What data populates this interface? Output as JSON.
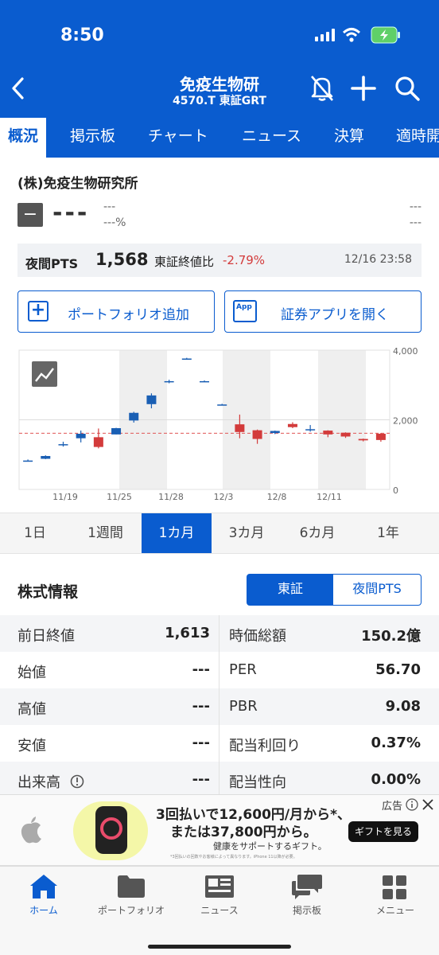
{
  "status_bar": {
    "time": "8:50"
  },
  "header": {
    "title": "免疫生物研",
    "subtitle": "4570.T 東証GRT"
  },
  "tabs": [
    "概況",
    "掲示板",
    "チャート",
    "ニュース",
    "決算",
    "適時開"
  ],
  "company": {
    "name": "(株)免疫生物研究所",
    "price": "---",
    "change": "---",
    "change_pct": "---%",
    "right_top": "---",
    "right_bottom": "---"
  },
  "pts": {
    "label": "夜間PTS",
    "value": "1,568",
    "compare_label": "東証終値比",
    "compare_value": "-2.79%",
    "timestamp": "12/16 23:58"
  },
  "buttons": {
    "portfolio": "ポートフォリオ追加",
    "open_app": "証券アプリを開く",
    "app_icon_text": "App"
  },
  "chart_data": {
    "type": "candlestick",
    "title": "",
    "xlabel": "",
    "ylabel": "",
    "ylim": [
      0,
      4000
    ],
    "y_ticks": [
      "4,000",
      "2,000",
      "0"
    ],
    "x_tick_labels": [
      "11/19",
      "11/25",
      "11/28",
      "12/3",
      "12/8",
      "12/11"
    ],
    "reference_line": 1613,
    "candles": [
      {
        "o": 830,
        "h": 860,
        "l": 800,
        "c": 830
      },
      {
        "o": 880,
        "h": 980,
        "l": 870,
        "c": 960
      },
      {
        "o": 1270,
        "h": 1370,
        "l": 1230,
        "c": 1300
      },
      {
        "o": 1470,
        "h": 1690,
        "l": 1350,
        "c": 1600
      },
      {
        "o": 1500,
        "h": 1750,
        "l": 1180,
        "c": 1220
      },
      {
        "o": 1580,
        "h": 1770,
        "l": 1580,
        "c": 1760
      },
      {
        "o": 1980,
        "h": 2230,
        "l": 1920,
        "c": 2200
      },
      {
        "o": 2450,
        "h": 2760,
        "l": 2330,
        "c": 2700
      },
      {
        "o": 3100,
        "h": 3150,
        "l": 3050,
        "c": 3110
      },
      {
        "o": 3760,
        "h": 3780,
        "l": 3730,
        "c": 3760
      },
      {
        "o": 3110,
        "h": 3130,
        "l": 3090,
        "c": 3110
      },
      {
        "o": 2440,
        "h": 2460,
        "l": 2420,
        "c": 2440
      },
      {
        "o": 1870,
        "h": 2150,
        "l": 1470,
        "c": 1650
      },
      {
        "o": 1700,
        "h": 1720,
        "l": 1310,
        "c": 1450
      },
      {
        "o": 1620,
        "h": 1690,
        "l": 1590,
        "c": 1680
      },
      {
        "o": 1880,
        "h": 1930,
        "l": 1760,
        "c": 1790
      },
      {
        "o": 1700,
        "h": 1850,
        "l": 1660,
        "c": 1730
      },
      {
        "o": 1690,
        "h": 1700,
        "l": 1500,
        "c": 1580
      },
      {
        "o": 1630,
        "h": 1640,
        "l": 1480,
        "c": 1520
      },
      {
        "o": 1450,
        "h": 1460,
        "l": 1380,
        "c": 1410
      },
      {
        "o": 1600,
        "h": 1620,
        "l": 1370,
        "c": 1420
      }
    ],
    "colors": {
      "up": "#1a5fb4",
      "down": "#d33b3b",
      "reference": "#e05555"
    }
  },
  "periods": [
    "1日",
    "1週間",
    "1カ月",
    "3カ月",
    "6カ月",
    "1年"
  ],
  "stock_info": {
    "title": "株式情報",
    "toggle": [
      "東証",
      "夜間PTS"
    ],
    "rows": [
      {
        "l1": "前日終値",
        "v1": "1,613",
        "l2": "時価総額",
        "v2": "150.2億"
      },
      {
        "l1": "始値",
        "v1": "---",
        "l2": "PER",
        "v2": "56.70"
      },
      {
        "l1": "高値",
        "v1": "---",
        "l2": "PBR",
        "v2": "9.08"
      },
      {
        "l1": "安値",
        "v1": "---",
        "l2": "配当利回り",
        "v2": "0.37%"
      },
      {
        "l1": "出来高",
        "v1": "---",
        "l2": "配当性向",
        "v2": "0.00%"
      }
    ]
  },
  "ad": {
    "line1": "3回払いで12,600円/月から*、",
    "line2": "または37,800円から。",
    "line3": "健康をサポートするギフト。",
    "fine": "*3回払いの回数やお客様によって異なります。iPhone 11以降が必要。",
    "cta": "ギフトを見る",
    "badge": "広告"
  },
  "bottom_nav": [
    "ホーム",
    "ポートフォリオ",
    "ニュース",
    "掲示板",
    "メニュー"
  ],
  "colors": {
    "brand": "#0a5ccf",
    "negative": "#d33b3b"
  }
}
